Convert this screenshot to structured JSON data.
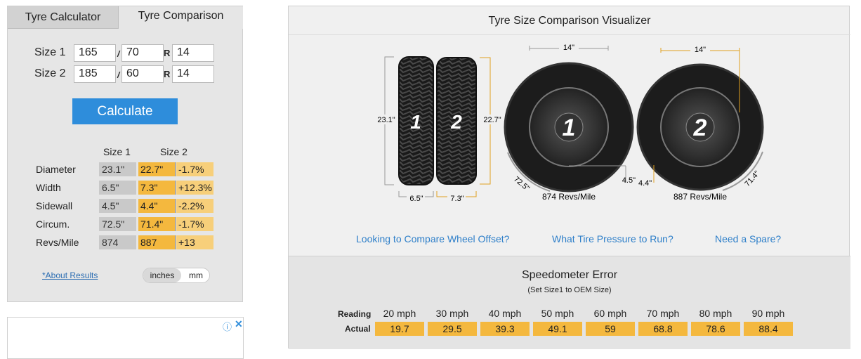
{
  "tabs": {
    "calculator": "Tyre Calculator",
    "comparison": "Tyre Comparison"
  },
  "form": {
    "size1_label": "Size 1",
    "size2_label": "Size 2",
    "sep": "/",
    "r": "R",
    "size1": {
      "width": "165",
      "aspect": "70",
      "rim": "14"
    },
    "size2": {
      "width": "185",
      "aspect": "60",
      "rim": "14"
    },
    "calculate": "Calculate"
  },
  "results": {
    "col1": "Size 1",
    "col2": "Size 2",
    "rows": [
      {
        "label": "Diameter",
        "s1": "23.1\"",
        "s2": "22.7\"",
        "diff": "-1.7%"
      },
      {
        "label": "Width",
        "s1": "6.5\"",
        "s2": "7.3\"",
        "diff": "+12.3%"
      },
      {
        "label": "Sidewall",
        "s1": "4.5\"",
        "s2": "4.4\"",
        "diff": "-2.2%"
      },
      {
        "label": "Circum.",
        "s1": "72.5\"",
        "s2": "71.4\"",
        "diff": "-1.7%"
      },
      {
        "label": "Revs/Mile",
        "s1": "874",
        "s2": "887",
        "diff": "+13"
      }
    ],
    "about": "*About Results",
    "unit_inches": "inches",
    "unit_mm": "mm"
  },
  "ad": {
    "info": "ⓘ",
    "close": "✕"
  },
  "visualizer": {
    "title": "Tyre Size Comparison Visualizer",
    "tread": {
      "height1": "23.1\"",
      "height2": "22.7\"",
      "width1": "6.5\"",
      "width2": "7.3\"",
      "num1": "1",
      "num2": "2"
    },
    "side1": {
      "rim": "14\"",
      "sidewall": "4.5\"",
      "circum": "72.5\"",
      "revs": "874 Revs/Mile",
      "num": "1"
    },
    "side2": {
      "rim": "14\"",
      "sidewall": "4.4\"",
      "circum": "71.4\"",
      "revs": "887 Revs/Mile",
      "num": "2"
    },
    "links": [
      "Looking to Compare Wheel Offset?",
      "What Tire Pressure to Run?",
      "Need a Spare?"
    ]
  },
  "speedometer": {
    "title": "Speedometer Error",
    "subtitle": "(Set Size1 to OEM Size)",
    "reading_label": "Reading",
    "actual_label": "Actual",
    "reading": [
      "20 mph",
      "30 mph",
      "40 mph",
      "50 mph",
      "60 mph",
      "70 mph",
      "80 mph",
      "90 mph"
    ],
    "actual": [
      "19.7",
      "29.5",
      "39.3",
      "49.1",
      "59",
      "68.8",
      "78.6",
      "88.4"
    ]
  },
  "colors": {
    "accent_blue": "#2e8ddb",
    "highlight": "#f4b83e",
    "highlight_light": "#f7cf7a"
  }
}
